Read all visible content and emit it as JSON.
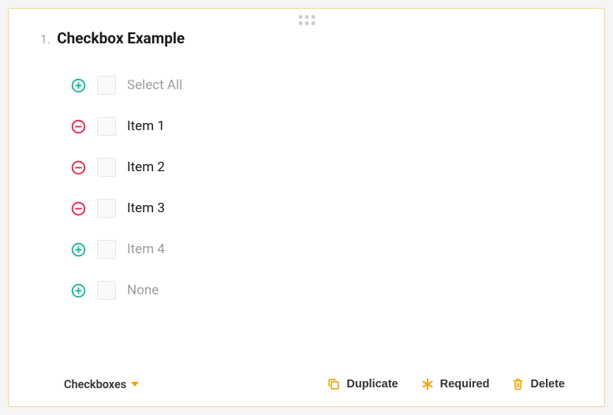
{
  "question": {
    "number": "1.",
    "title": "Checkbox Example"
  },
  "options": {
    "select_all": "Select All",
    "item1": "Item 1",
    "item2": "Item 2",
    "item3": "Item 3",
    "item4": "Item 4",
    "none": "None"
  },
  "footer": {
    "type_label": "Checkboxes",
    "duplicate": "Duplicate",
    "required": "Required",
    "delete": "Delete"
  },
  "colors": {
    "add": "#17b897",
    "remove": "#e8204e",
    "accent": "#f2a100"
  }
}
